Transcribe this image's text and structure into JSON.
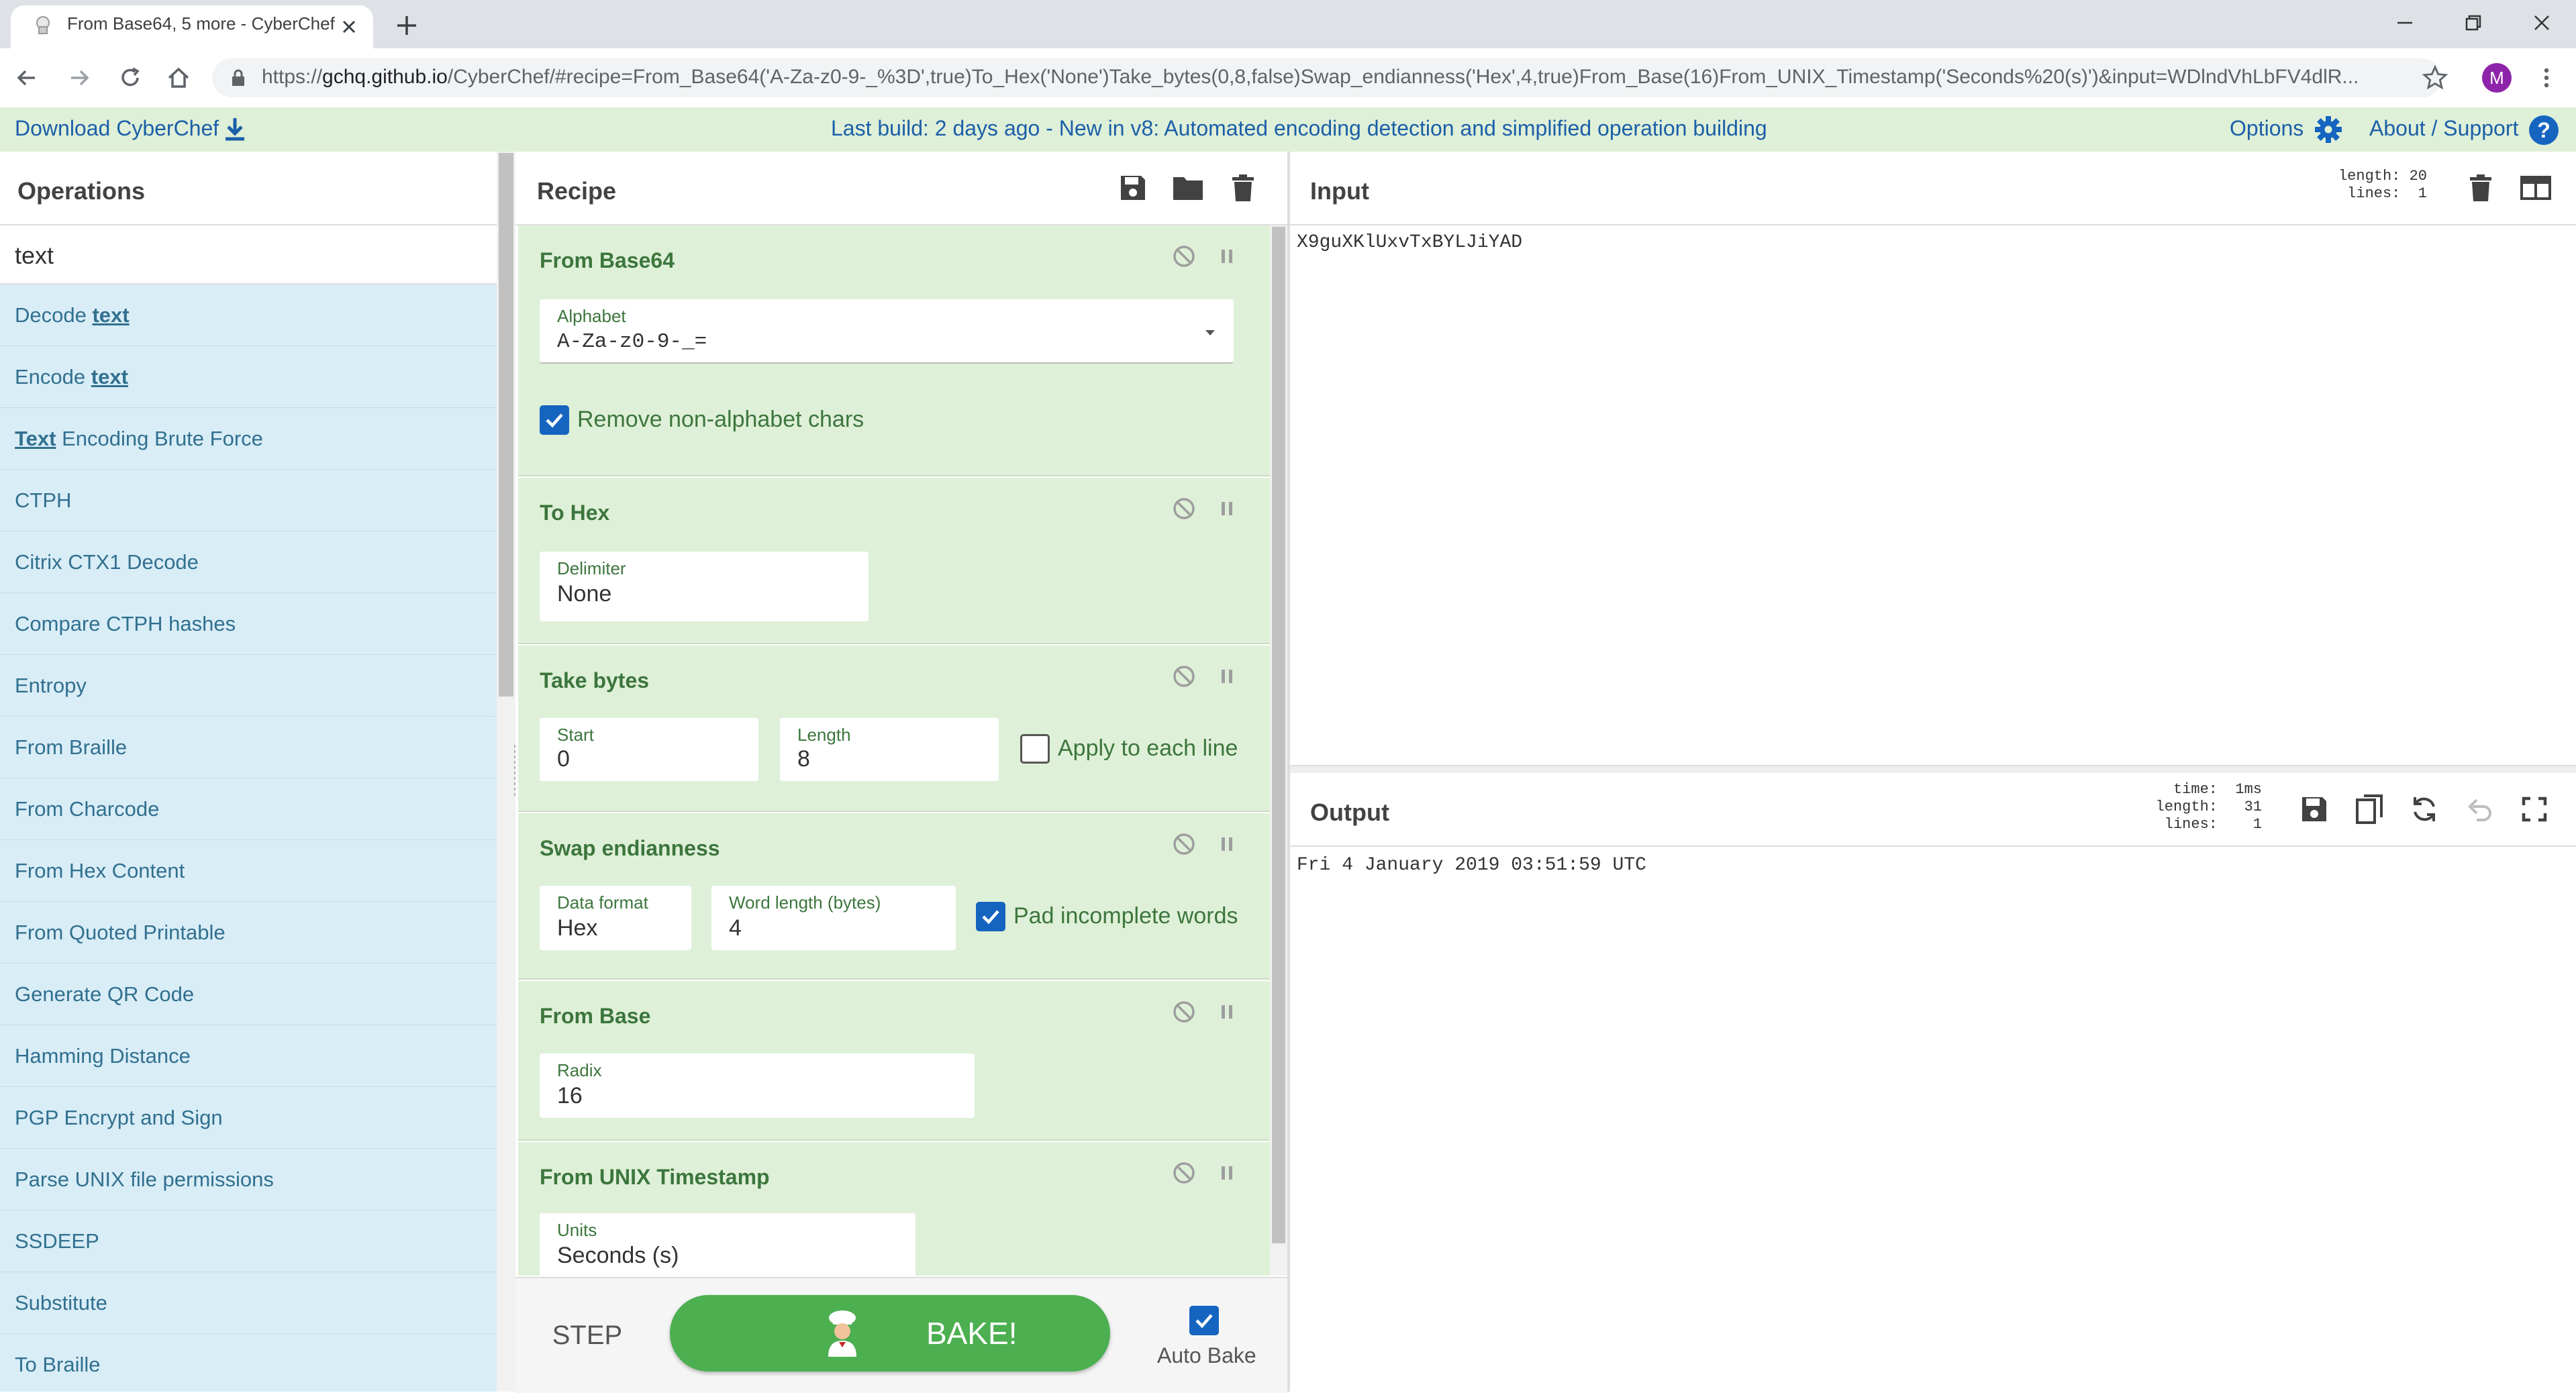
{
  "browser": {
    "tab_title": "From Base64, 5 more - CyberChef",
    "url_scheme": "https://",
    "url_host": "gchq.github.io",
    "url_rest": "/CyberChef/#recipe=From_Base64('A-Za-z0-9-_%3D',true)To_Hex('None')Take_bytes(0,8,false)Swap_endianness('Hex',4,true)From_Base(16)From_UNIX_Timestamp('Seconds%20(s)')&input=WDlndVhLbFV4dlR...",
    "profile_initial": "M"
  },
  "banner": {
    "download_label": "Download CyberChef",
    "build_notice": "Last build: 2 days ago - New in v8: Automated encoding detection and simplified operation building",
    "options_label": "Options",
    "about_label": "About / Support"
  },
  "operations": {
    "title": "Operations",
    "search_value": "text",
    "items": [
      {
        "pre": "Decode ",
        "match": "text",
        "post": ""
      },
      {
        "pre": "Encode ",
        "match": "text",
        "post": ""
      },
      {
        "pre": "",
        "match": "Text",
        "post": " Encoding Brute Force"
      },
      {
        "pre": "CTPH",
        "match": "",
        "post": ""
      },
      {
        "pre": "Citrix CTX1 Decode",
        "match": "",
        "post": ""
      },
      {
        "pre": "Compare CTPH hashes",
        "match": "",
        "post": ""
      },
      {
        "pre": "Entropy",
        "match": "",
        "post": ""
      },
      {
        "pre": "From Braille",
        "match": "",
        "post": ""
      },
      {
        "pre": "From Charcode",
        "match": "",
        "post": ""
      },
      {
        "pre": "From Hex Content",
        "match": "",
        "post": ""
      },
      {
        "pre": "From Quoted Printable",
        "match": "",
        "post": ""
      },
      {
        "pre": "Generate QR Code",
        "match": "",
        "post": ""
      },
      {
        "pre": "Hamming Distance",
        "match": "",
        "post": ""
      },
      {
        "pre": "PGP Encrypt and Sign",
        "match": "",
        "post": ""
      },
      {
        "pre": "Parse UNIX file permissions",
        "match": "",
        "post": ""
      },
      {
        "pre": "SSDEEP",
        "match": "",
        "post": ""
      },
      {
        "pre": "Substitute",
        "match": "",
        "post": ""
      },
      {
        "pre": "To Braille",
        "match": "",
        "post": ""
      }
    ]
  },
  "recipe": {
    "title": "Recipe",
    "ops": {
      "from_base64": {
        "title": "From Base64",
        "alphabet_label": "Alphabet",
        "alphabet_value": "A-Za-z0-9-_=",
        "remove_label": "Remove non-alphabet chars",
        "remove_checked": true
      },
      "to_hex": {
        "title": "To Hex",
        "delimiter_label": "Delimiter",
        "delimiter_value": "None"
      },
      "take_bytes": {
        "title": "Take bytes",
        "start_label": "Start",
        "start_value": "0",
        "length_label": "Length",
        "length_value": "8",
        "each_line_label": "Apply to each line",
        "each_line_checked": false
      },
      "swap_endianness": {
        "title": "Swap endianness",
        "format_label": "Data format",
        "format_value": "Hex",
        "word_label": "Word length (bytes)",
        "word_value": "4",
        "pad_label": "Pad incomplete words",
        "pad_checked": true
      },
      "from_base": {
        "title": "From Base",
        "radix_label": "Radix",
        "radix_value": "16"
      },
      "from_unix": {
        "title": "From UNIX Timestamp",
        "units_label": "Units",
        "units_value": "Seconds (s)"
      }
    },
    "step_label": "STEP",
    "bake_label": "BAKE!",
    "autobake_label": "Auto Bake",
    "autobake_checked": true
  },
  "input": {
    "title": "Input",
    "stats": "length: 20\n lines:  1",
    "text": "X9guXKlUxvTxBYLJiYAD"
  },
  "output": {
    "title": "Output",
    "stats": "  time:  1ms\nlength:   31\n lines:    1",
    "text": "Fri 4 January 2019 03:51:59 UTC"
  },
  "colors": {
    "accent_green": "#4caf50",
    "op_bg": "#dff0d8",
    "op_title": "#3c763d",
    "ops_list_bg": "#d9edf7",
    "link_blue": "#1b5fa8",
    "checkbox_blue": "#1565c0"
  }
}
